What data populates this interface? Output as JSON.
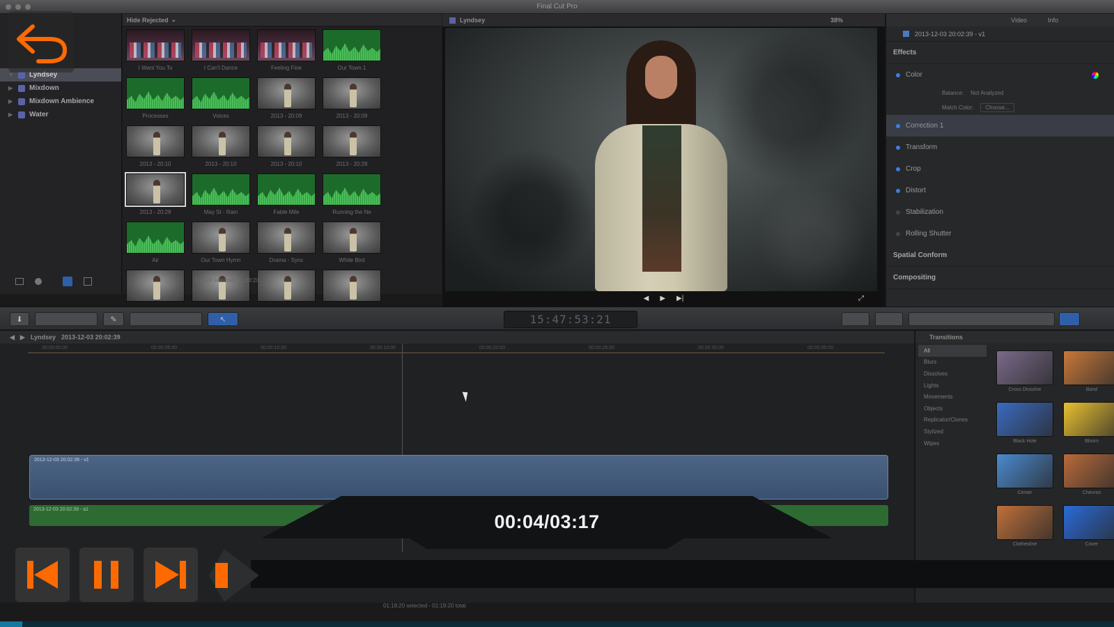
{
  "app": {
    "title": "Final Cut Pro"
  },
  "libraries": {
    "items": [
      {
        "label": "Lyndsey",
        "selected": true
      },
      {
        "label": "Mixdown"
      },
      {
        "label": "Mixdown Ambience"
      },
      {
        "label": "Water"
      }
    ]
  },
  "browser": {
    "filter_label": "Hide Rejected",
    "clips": [
      {
        "type": "crowd",
        "label": "I Want You To"
      },
      {
        "type": "crowd",
        "label": "I Can't Dance"
      },
      {
        "type": "crowd",
        "label": "Feeling Fine"
      },
      {
        "type": "audio",
        "label": "Our Town 1"
      },
      {
        "type": "audio",
        "label": "Processes"
      },
      {
        "type": "audio",
        "label": "Voices"
      },
      {
        "type": "video",
        "label": "2013 - 20:09"
      },
      {
        "type": "video",
        "label": "2013 - 20:09"
      },
      {
        "type": "video",
        "label": "2013 - 20:10"
      },
      {
        "type": "video",
        "label": "2013 - 20:10"
      },
      {
        "type": "video",
        "label": "2013 - 20:10"
      },
      {
        "type": "video",
        "label": "2013 - 20:28"
      },
      {
        "type": "video",
        "label": "2013 - 20:28",
        "selected": true
      },
      {
        "type": "audio",
        "label": "May St - Rain"
      },
      {
        "type": "audio",
        "label": "Fable Mile"
      },
      {
        "type": "audio",
        "label": "Running the Ne"
      },
      {
        "type": "audio",
        "label": "Air"
      },
      {
        "type": "video",
        "label": "Our Town Hymn"
      },
      {
        "type": "video",
        "label": "Drama - Sync"
      },
      {
        "type": "video",
        "label": "White Bird"
      },
      {
        "type": "video",
        "label": ""
      },
      {
        "type": "video",
        "label": ""
      },
      {
        "type": "video",
        "label": ""
      },
      {
        "type": "video",
        "label": ""
      }
    ],
    "footer_text": "1 of 24 selected, 01:18:20"
  },
  "viewer": {
    "title": "Lyndsey",
    "zoom": "38%"
  },
  "inspector": {
    "tabs": [
      "Video",
      "Info"
    ],
    "clip_name": "2013-12-03 20:02:39 - v1",
    "effects_label": "Effects",
    "rows": [
      {
        "label": "Color",
        "on": true
      },
      {
        "label": "Correction 1",
        "on": true,
        "highlight": true
      },
      {
        "label": "Transform",
        "on": true
      },
      {
        "label": "Crop",
        "on": true
      },
      {
        "label": "Distort",
        "on": true
      },
      {
        "label": "Stabilization",
        "on": false
      },
      {
        "label": "Rolling Shutter",
        "on": false
      }
    ],
    "balance_label": "Balance:",
    "balance_value": "Not Analyzed",
    "match_label": "Match Color:",
    "match_value": "Choose...",
    "spatial_label": "Spatial Conform",
    "compositing_label": "Compositing"
  },
  "toolbar": {
    "timecode": "15:47:53:21"
  },
  "timeline": {
    "project": "Lyndsey",
    "clip_name": "2013-12-03 20:02:39",
    "ruler_ticks": [
      "00:00:00:00",
      "00:00:05:00",
      "00:00:10:00",
      "00:00:15:00",
      "00:00:20:00",
      "00:00:25:00",
      "00:00:30:00",
      "00:00:35:00"
    ],
    "video_clip_label": "2013-12-03 20:02:39 - v1",
    "audio_clip_label": "2013-12-03 20:02:39 - a1",
    "footer_text": "01:18:20 selected - 01:18:20 total"
  },
  "transitions": {
    "title": "Transitions",
    "categories": [
      "All",
      "Blurs",
      "Dissolves",
      "Lights",
      "Movements",
      "Objects",
      "Replicator/Clones",
      "Stylized",
      "Wipes"
    ],
    "items": [
      {
        "label": "Cross Dissolve",
        "color": "#7a6a8a"
      },
      {
        "label": "Band",
        "color": "#c8783a"
      },
      {
        "label": "Black Hole",
        "color": "#3a6ac0"
      },
      {
        "label": "Bloom",
        "color": "#e8c030"
      },
      {
        "label": "Center",
        "color": "#4a8ad0"
      },
      {
        "label": "Chevron",
        "color": "#b86a3a"
      },
      {
        "label": "Clothesline",
        "color": "#c0703a"
      },
      {
        "label": "Cover",
        "color": "#2a6ad8"
      }
    ]
  },
  "player": {
    "time_display": "00:04/03:17",
    "progress": 0.02,
    "accent": "#ff6a00",
    "icons": [
      "undo-arrow-icon",
      "skip-back-icon",
      "pause-icon",
      "skip-forward-icon"
    ]
  }
}
